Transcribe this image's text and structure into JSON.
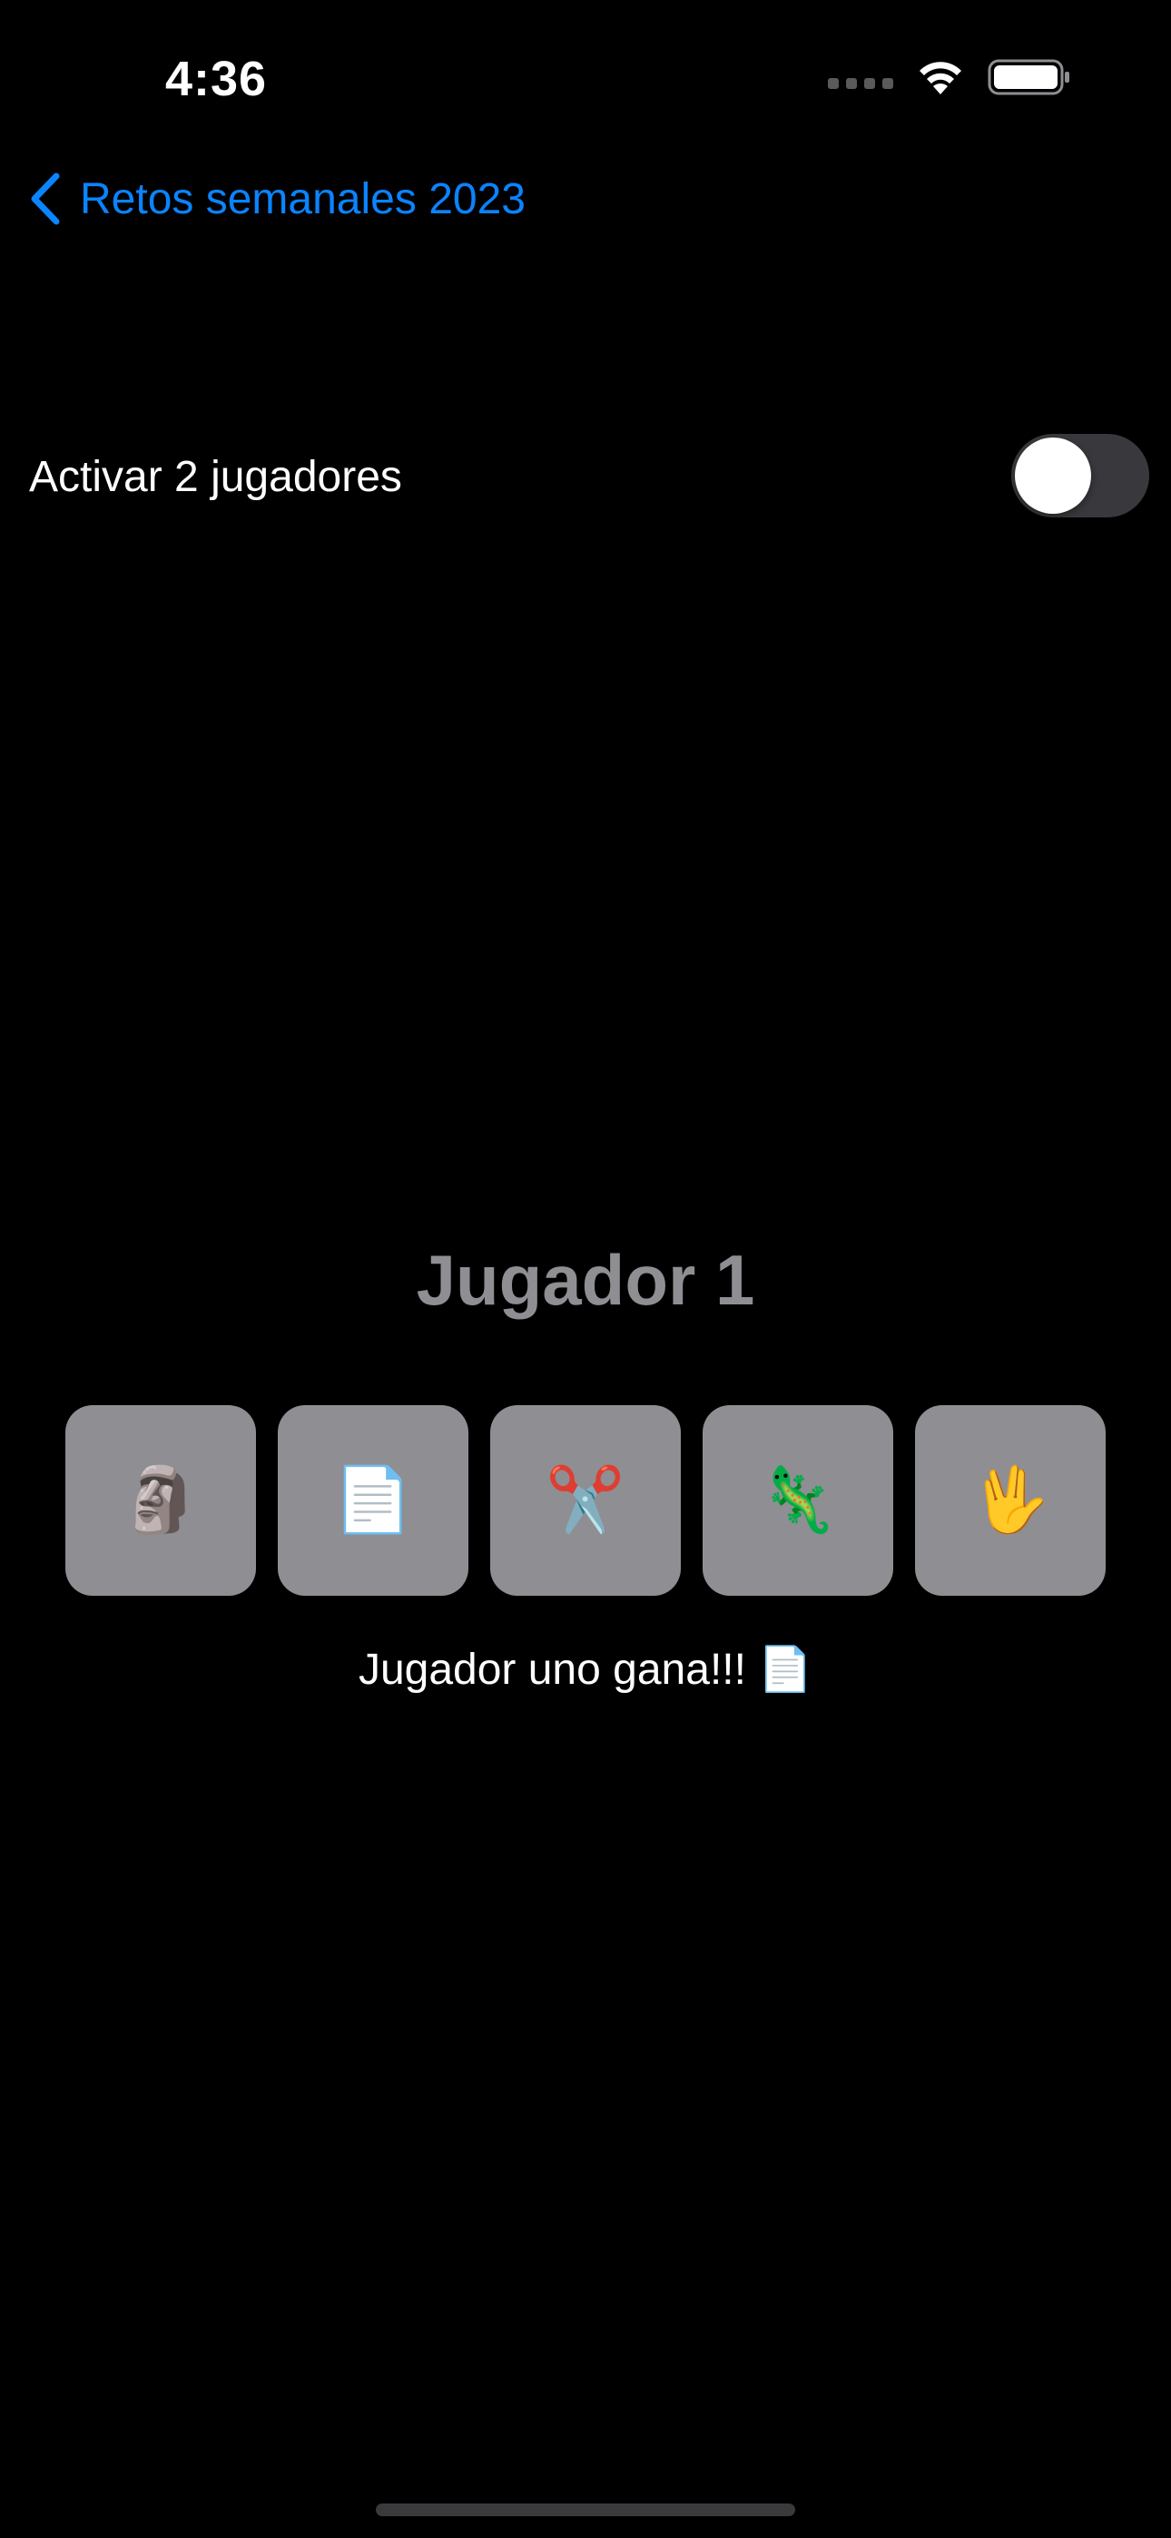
{
  "status_bar": {
    "time": "4:36"
  },
  "nav": {
    "back_label": "Retos semanales 2023",
    "accent_color": "#0a84ff"
  },
  "settings": {
    "two_players_label": "Activar 2 jugadores",
    "two_players_enabled": false
  },
  "game": {
    "player_title": "Jugador 1",
    "choices": [
      {
        "icon": "moai-stone-icon",
        "glyph": "🗿"
      },
      {
        "icon": "paper-page-icon",
        "glyph": "📄"
      },
      {
        "icon": "scissors-icon",
        "glyph": "✂️"
      },
      {
        "icon": "lizard-icon",
        "glyph": "🦎"
      },
      {
        "icon": "vulcan-salute-icon",
        "glyph": "🖖"
      }
    ],
    "result": "Jugador uno gana!!! 📄"
  }
}
